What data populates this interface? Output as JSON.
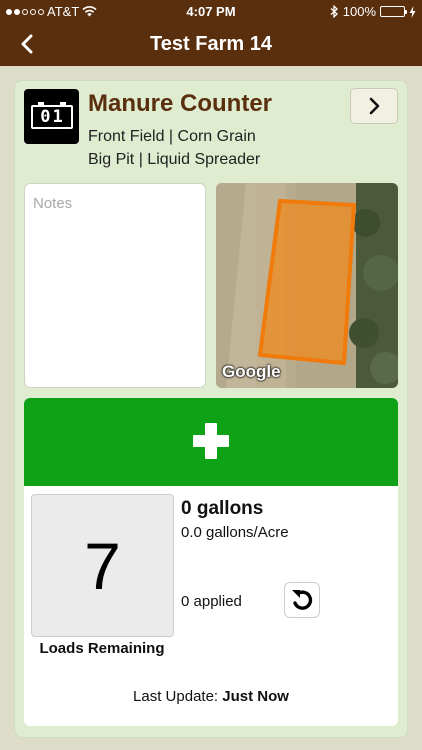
{
  "status_bar": {
    "carrier": "AT&T",
    "time": "4:07 PM",
    "battery": "100%"
  },
  "nav": {
    "title": "Test Farm 14"
  },
  "counter": {
    "title": "Manure Counter",
    "field_line": "Front Field | Corn Grain",
    "source_line": "Big Pit | Liquid Spreader"
  },
  "notes": {
    "placeholder": "Notes"
  },
  "map": {
    "attribution": "Google"
  },
  "stats": {
    "loads_remaining": "7",
    "loads_label": "Loads Remaining",
    "gallons": "0 gallons",
    "rate": "0.0 gallons/Acre",
    "applied": "0 applied"
  },
  "last_update": {
    "label": "Last Update:",
    "value": "Just Now"
  },
  "colors": {
    "brand_brown": "#5a2f0e",
    "add_green": "#0fa216",
    "field_orange": "#f08a1e",
    "card_bg": "#dfecd0"
  }
}
